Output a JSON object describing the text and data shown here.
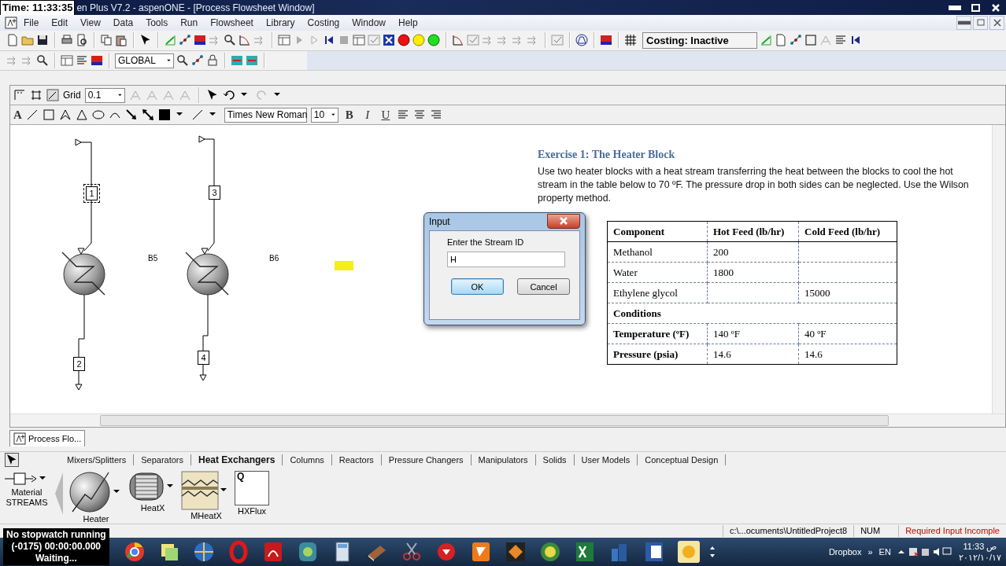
{
  "title_bar": {
    "time_overlay": "Time: 11:33:35",
    "title": "en Plus V7.2 - aspenONE - [Process Flowsheet Window]"
  },
  "menu_bar": [
    "File",
    "Edit",
    "View",
    "Data",
    "Tools",
    "Run",
    "Flowsheet",
    "Library",
    "Costing",
    "Window",
    "Help"
  ],
  "toolbar": {
    "costing_status": "Costing: Inactive",
    "scope": "GLOBAL"
  },
  "flowsheet_toolbar": {
    "grid_label": "Grid",
    "grid_value": "0.1",
    "text_tool": "A",
    "font": "Times New Roman",
    "font_size": "10",
    "format_buttons": [
      "B",
      "I",
      "U"
    ]
  },
  "flowsheet": {
    "streams": [
      {
        "label": "1",
        "selected": true
      },
      {
        "label": "2",
        "selected": false
      },
      {
        "label": "3",
        "selected": false
      },
      {
        "label": "4",
        "selected": false
      }
    ],
    "blocks": [
      {
        "label": "B5"
      },
      {
        "label": "B6"
      }
    ]
  },
  "exercise": {
    "title": "Exercise 1: The Heater Block",
    "text": "Use two heater blocks with a heat stream transferring the heat between the blocks to cool the hot stream in the table below to 70 ºF. The pressure drop in both sides can be neglected. Use the Wilson property method.",
    "table": {
      "columns": [
        "Component",
        "Hot Feed (lb/hr)",
        "Cold Feed (lb/hr)"
      ],
      "rows": [
        {
          "kind": "data",
          "cells": [
            "Methanol",
            "200",
            ""
          ]
        },
        {
          "kind": "data",
          "cells": [
            "Water",
            "1800",
            ""
          ]
        },
        {
          "kind": "data",
          "cells": [
            "Ethylene glycol",
            "",
            "15000"
          ]
        },
        {
          "kind": "section",
          "cells": [
            {
              "text": "Conditions",
              "colspan": 3
            }
          ]
        },
        {
          "kind": "condition",
          "cells": [
            "Temperature (ºF)",
            "140 ºF",
            "40 ºF"
          ]
        },
        {
          "kind": "condition",
          "cells": [
            "Pressure (psia)",
            "14.6",
            "14.6"
          ]
        }
      ]
    }
  },
  "dialog": {
    "title": "Input",
    "prompt": "Enter the Stream ID",
    "value": "H",
    "buttons": [
      {
        "label": "OK",
        "default": true
      },
      {
        "label": "Cancel",
        "default": false
      }
    ]
  },
  "window_tab": "Process Flo...",
  "model_palette": {
    "tabs": [
      {
        "label": "Mixers/Splitters",
        "selected": false
      },
      {
        "label": "Separators",
        "selected": false
      },
      {
        "label": "Heat Exchangers",
        "selected": true
      },
      {
        "label": "Columns",
        "selected": false
      },
      {
        "label": "Reactors",
        "selected": false
      },
      {
        "label": "Pressure Changers",
        "selected": false
      },
      {
        "label": "Manipulators",
        "selected": false
      },
      {
        "label": "Solids",
        "selected": false
      },
      {
        "label": "User Models",
        "selected": false
      },
      {
        "label": "Conceptual Design",
        "selected": false
      }
    ],
    "streams_item": {
      "label": "Material",
      "group": "STREAMS"
    },
    "models": [
      {
        "label": "Heater",
        "kind": "heater"
      },
      {
        "label": "HeatX",
        "kind": "heatx"
      },
      {
        "label": "MHeatX",
        "kind": "mheatx"
      },
      {
        "label": "HXFlux",
        "kind": "hxflux",
        "icon_text": "Q"
      }
    ]
  },
  "status_bar": [
    {
      "text": "c:\\...ocuments\\UntitledProject8",
      "kind": "path"
    },
    {
      "text": "NUM",
      "kind": "mode"
    },
    {
      "text": "Required Input Incomple",
      "kind": "alert"
    }
  ],
  "stopwatch": [
    "No stopwatch running",
    "(-0175)  00:00:00.000",
    "Waiting..."
  ],
  "taskbar": {
    "tray_label": "Dropbox",
    "more": "»",
    "language": "EN",
    "time": "ص 11:33",
    "date": "٢٠١٢/١٠/١٧"
  }
}
